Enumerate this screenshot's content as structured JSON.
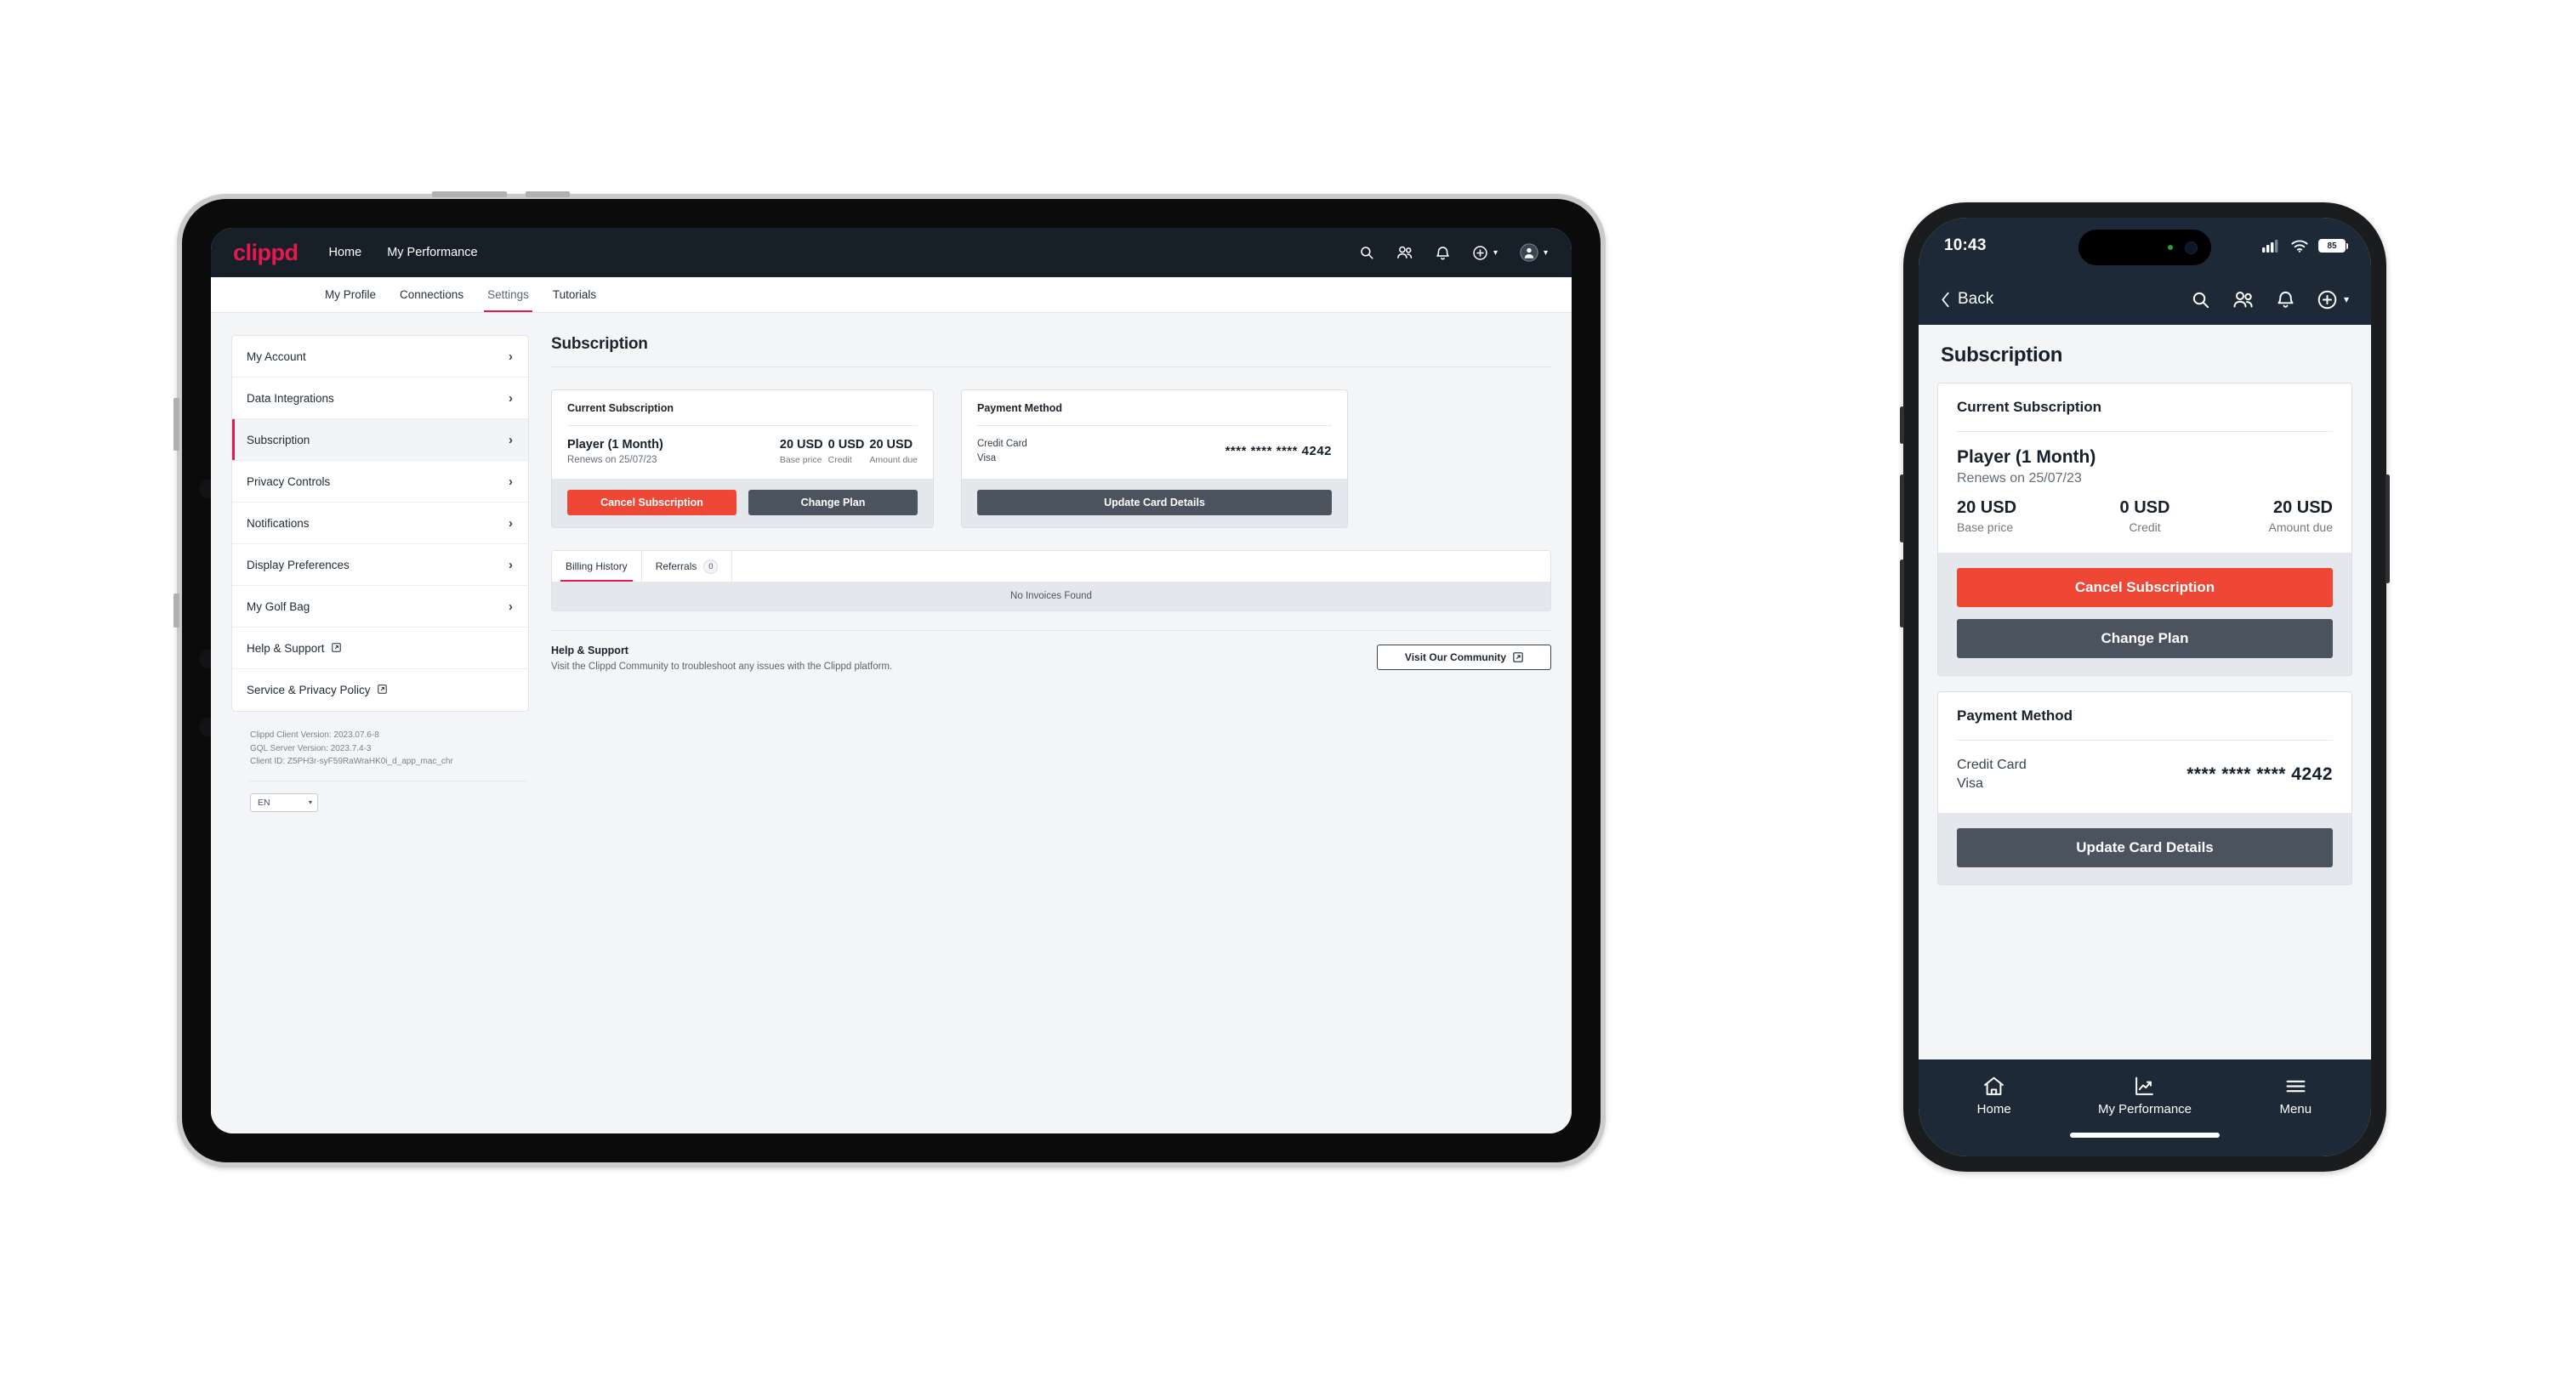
{
  "brand": {
    "name": "clippd",
    "accent": "#e8174c",
    "dark": "#172029",
    "red_button": "#ee4735",
    "dark_button": "#4b545e"
  },
  "tablet": {
    "topnav": {
      "logo": "clippd",
      "links": [
        "Home",
        "My Performance"
      ],
      "icons": [
        "search-icon",
        "people-icon",
        "bell-icon",
        "plus-circle-icon",
        "avatar-icon"
      ]
    },
    "tabs": [
      {
        "label": "My Profile",
        "active": false
      },
      {
        "label": "Connections",
        "active": false
      },
      {
        "label": "Settings",
        "active": true
      },
      {
        "label": "Tutorials",
        "active": false
      }
    ],
    "sidebar": {
      "items": [
        {
          "label": "My Account",
          "selected": false,
          "external": false
        },
        {
          "label": "Data Integrations",
          "selected": false,
          "external": false
        },
        {
          "label": "Subscription",
          "selected": true,
          "external": false
        },
        {
          "label": "Privacy Controls",
          "selected": false,
          "external": false
        },
        {
          "label": "Notifications",
          "selected": false,
          "external": false
        },
        {
          "label": "Display Preferences",
          "selected": false,
          "external": false
        },
        {
          "label": "My Golf Bag",
          "selected": false,
          "external": false
        },
        {
          "label": "Help & Support",
          "selected": false,
          "external": true
        },
        {
          "label": "Service & Privacy Policy",
          "selected": false,
          "external": true
        }
      ],
      "version": {
        "client": "Clippd Client Version: 2023.07.6-8",
        "server": "GQL Server Version: 2023.7.4-3",
        "client_id": "Client ID: Z5PH3r-syF59RaWraHK0i_d_app_mac_chr"
      },
      "language": {
        "value": "EN"
      }
    },
    "main": {
      "page_title": "Subscription",
      "subscription_card": {
        "title": "Current Subscription",
        "plan_name": "Player (1 Month)",
        "renews": "Renews on 25/07/23",
        "amounts": [
          {
            "value": "20 USD",
            "label": "Base price"
          },
          {
            "value": "0 USD",
            "label": "Credit"
          },
          {
            "value": "20 USD",
            "label": "Amount due"
          }
        ],
        "cancel_label": "Cancel Subscription",
        "change_label": "Change Plan"
      },
      "payment_card": {
        "title": "Payment Method",
        "type": "Credit Card",
        "network": "Visa",
        "number": "**** **** **** 4242",
        "update_label": "Update Card Details"
      },
      "history": {
        "tabs": [
          {
            "label": "Billing History",
            "active": true,
            "badge": null
          },
          {
            "label": "Referrals",
            "active": false,
            "badge": "0"
          }
        ],
        "empty_text": "No Invoices Found"
      },
      "help": {
        "title": "Help & Support",
        "text": "Visit the Clippd Community to troubleshoot any issues with the Clippd platform.",
        "button_label": "Visit Our Community"
      }
    }
  },
  "phone": {
    "status": {
      "time": "10:43",
      "battery": "85"
    },
    "navbar": {
      "back_label": "Back",
      "icons": [
        "search-icon",
        "people-icon",
        "bell-icon",
        "plus-circle-icon"
      ]
    },
    "page_title": "Subscription",
    "subscription_card": {
      "title": "Current Subscription",
      "plan_name": "Player (1 Month)",
      "renews": "Renews on 25/07/23",
      "amounts": [
        {
          "value": "20 USD",
          "label": "Base price"
        },
        {
          "value": "0 USD",
          "label": "Credit"
        },
        {
          "value": "20 USD",
          "label": "Amount due"
        }
      ],
      "cancel_label": "Cancel Subscription",
      "change_label": "Change Plan"
    },
    "payment_card": {
      "title": "Payment Method",
      "type": "Credit Card",
      "network": "Visa",
      "number": "**** **** **** 4242",
      "update_label": "Update Card Details"
    },
    "bottomnav": [
      {
        "label": "Home",
        "icon": "home-icon"
      },
      {
        "label": "My Performance",
        "icon": "chart-icon"
      },
      {
        "label": "Menu",
        "icon": "hamburger-icon"
      }
    ]
  }
}
